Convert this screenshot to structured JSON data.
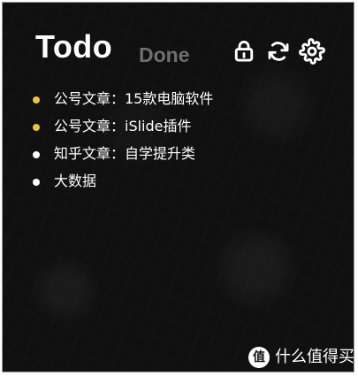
{
  "header": {
    "tabs": [
      {
        "label": "Todo",
        "state": "active",
        "color": "#ffffff"
      },
      {
        "label": "Done",
        "state": "inactive",
        "color": "#6f6f6f"
      }
    ],
    "icons": [
      {
        "name": "lock-icon"
      },
      {
        "name": "refresh-icon"
      },
      {
        "name": "settings-icon"
      }
    ]
  },
  "tasks": [
    {
      "text": "公号文章：15款电脑软件",
      "marker_color": "#f0c23a"
    },
    {
      "text": "公号文章：iSlide插件",
      "marker_color": "#f0c23a"
    },
    {
      "text": "知乎文章：自学提升类",
      "marker_color": "#ffffff"
    },
    {
      "text": "大数据",
      "marker_color": "#ffffff"
    }
  ],
  "watermark": {
    "logo_text": "值",
    "text": "什么值得买"
  }
}
